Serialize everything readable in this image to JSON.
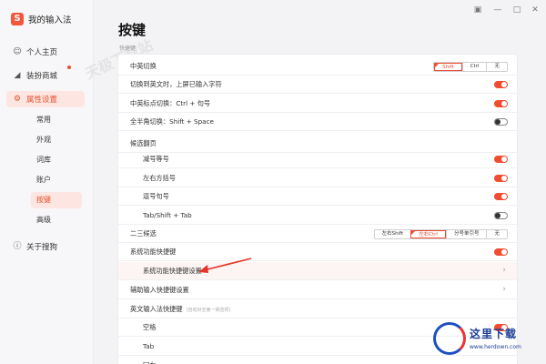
{
  "brand": {
    "name": "我的输入法"
  },
  "sidebar": {
    "nav": [
      {
        "label": "个人主页",
        "icon": "person-icon"
      },
      {
        "label": "装扮商城",
        "icon": "shirt-icon",
        "badge_dot": true
      },
      {
        "label": "属性设置",
        "icon": "gear-icon",
        "active": true
      },
      {
        "label": "关于搜狗",
        "icon": "info-icon"
      }
    ],
    "sub": [
      "常用",
      "外观",
      "词库",
      "账户",
      "按键",
      "高级"
    ],
    "active_sub": "按键"
  },
  "window_controls": [
    "message-icon",
    "minimize-icon",
    "maximize-icon",
    "close-icon"
  ],
  "page": {
    "title": "按键",
    "crumb": "快捷键"
  },
  "settings": {
    "cn_en_switch": {
      "label": "中英切换",
      "options": [
        "Shift",
        "Ctrl",
        "无"
      ],
      "selected": "Shift"
    },
    "switch_en_commit": {
      "label": "切换到英文时，上屏已输入字符",
      "on": true
    },
    "cn_en_punct": {
      "label": "中英标点切换：Ctrl + 句号",
      "on": true
    },
    "full_half": {
      "label": "全半角切换：Shift + Space",
      "on": false
    },
    "candidate_page": {
      "label": "候选翻页"
    },
    "minus_equal": {
      "label": "减号等号",
      "on": true
    },
    "brackets": {
      "label": "左右方括号",
      "on": true
    },
    "comma_period": {
      "label": "逗号句号",
      "on": true
    },
    "tab": {
      "label": "Tab/Shift + Tab",
      "on": false
    },
    "second_third": {
      "label": "二三候选",
      "options": [
        "左右Shift",
        "左右Ctrl",
        "分号单引号",
        "无"
      ],
      "selected": "左右Ctrl"
    },
    "sys_shortcut": {
      "label": "系统功能快捷键",
      "on": true
    },
    "sys_shortcut_settings": {
      "label": "系统功能快捷键设置"
    },
    "aux_shortcut": {
      "label": "辅助输入快捷键设置"
    },
    "en_shortcut": {
      "label": "英文输入法快捷键",
      "hint": "(自动对全第一候选项)"
    },
    "space": {
      "label": "空格",
      "on": true
    },
    "tab_key": {
      "label": "Tab"
    },
    "enter_key": {
      "label": "回车"
    }
  },
  "watermark": {
    "brand": "这里下载",
    "url": "www.herdown.com"
  },
  "colors": {
    "accent": "#f04c2f",
    "active_bg": "#fde6e1"
  }
}
